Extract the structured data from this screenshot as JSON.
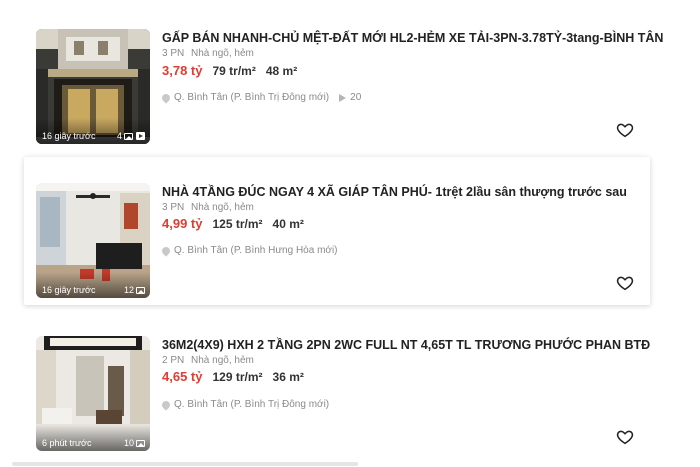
{
  "listings": [
    {
      "title": "GẤP BÁN NHANH-CHỦ MỆT-ĐẤT MỚI HL2-HẺM XE TẢI-3PN-3.78TỶ-3tang-BÌNH TÂN",
      "bedrooms": "3 PN",
      "type": "Nhà ngõ, hẻm",
      "price": "3,78 tỷ",
      "price_per_m2": "79 tr/m²",
      "area": "48 m²",
      "location": "Q. Bình Tân (P. Bình Trị Đông mới)",
      "views": "20",
      "posted": "16 giây trước",
      "photo_count": "4",
      "has_video": true,
      "heart_icon": "heart-outline-icon"
    },
    {
      "title": "NHÀ 4TẦNG ĐÚC NGAY 4 XÃ GIÁP TÂN PHÚ- 1trệt 2lầu sân thượng trước sau",
      "bedrooms": "3 PN",
      "type": "Nhà ngõ, hẻm",
      "price": "4,99 tỷ",
      "price_per_m2": "125 tr/m²",
      "area": "40 m²",
      "location": "Q. Bình Tân (P. Bình Hưng Hòa mới)",
      "posted": "16 giây trước",
      "photo_count": "12",
      "heart_icon": "heart-outline-icon"
    },
    {
      "title": "36M2(4X9) HXH 2 TẦNG 2PN 2WC FULL NT 4,65T TL TRƯƠNG PHƯỚC PHAN BTĐ",
      "bedrooms": "2 PN",
      "type": "Nhà ngõ, hẻm",
      "price": "4,65 tỷ",
      "price_per_m2": "129 tr/m²",
      "area": "36 m²",
      "location": "Q. Bình Tân (P. Bình Trị Đông mới)",
      "posted": "6 phút trước",
      "photo_count": "10",
      "heart_icon": "heart-outline-icon"
    }
  ],
  "colors": {
    "price": "#e03c31",
    "muted": "#8a8a8a",
    "title": "#222222"
  }
}
